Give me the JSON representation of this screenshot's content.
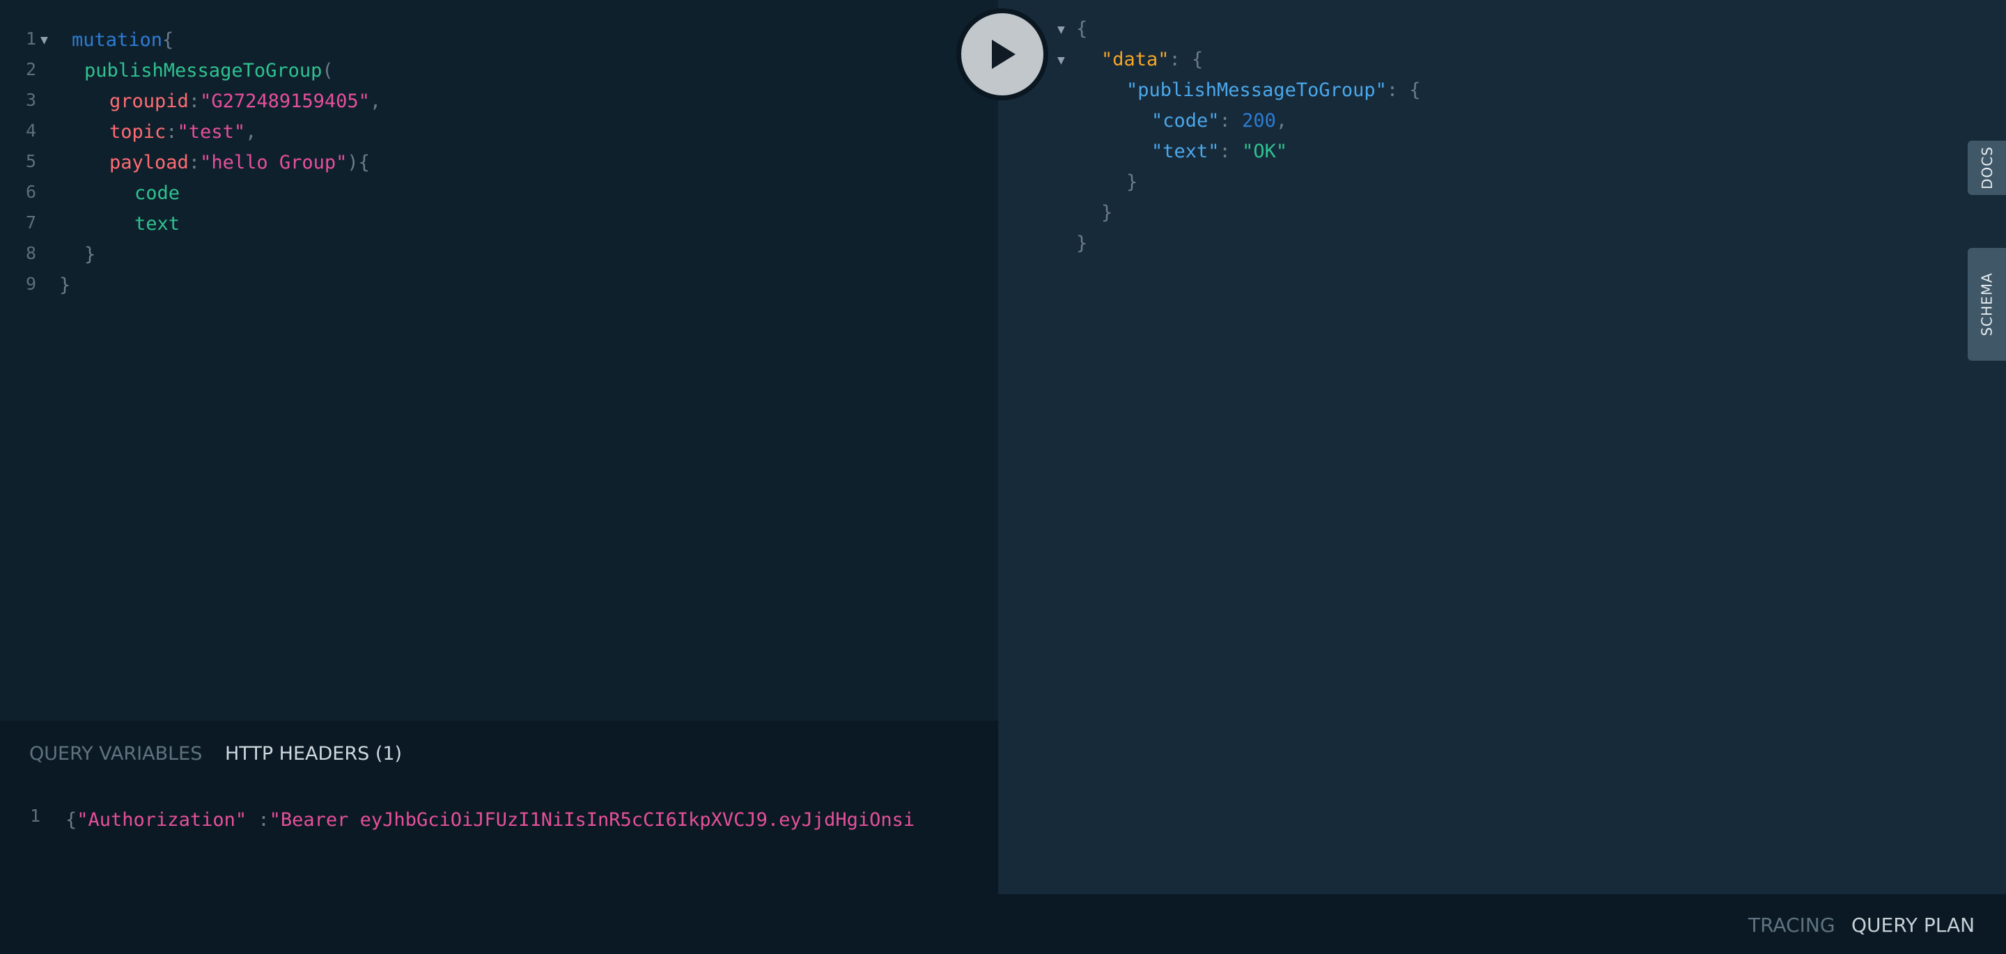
{
  "editor": {
    "line_numbers": [
      "1",
      "2",
      "3",
      "4",
      "5",
      "6",
      "7",
      "8",
      "9"
    ],
    "lines": {
      "l1_kw": "mutation",
      "l1_brace": "{",
      "l2_field": "publishMessageToGroup",
      "l2_paren": "(",
      "l3_arg": "groupid",
      "l3_colon": ":",
      "l3_str": "\"G272489159405\"",
      "l3_comma": ",",
      "l4_arg": "topic",
      "l4_colon": ":",
      "l4_str": "\"test\"",
      "l4_comma": ",",
      "l5_arg": "payload",
      "l5_colon": ":",
      "l5_str": "\"hello Group\"",
      "l5_close": "){",
      "l6_field": "code",
      "l7_field": "text",
      "l8_brace": "}",
      "l9_brace": "}"
    }
  },
  "run_button": {
    "icon": "play-icon"
  },
  "result": {
    "open_brace": "{",
    "data_key": "\"data\"",
    "colon_brace": ": {",
    "pub_key": "\"publishMessageToGroup\"",
    "code_key": "\"code\"",
    "colon": ": ",
    "code_val": "200",
    "comma": ",",
    "text_key": "\"text\"",
    "text_val": "\"OK\"",
    "close_brace": "}"
  },
  "side_tabs": {
    "docs": "DOCS",
    "schema": "SCHEMA"
  },
  "bottom": {
    "tabs": {
      "query_variables": "QUERY VARIABLES",
      "http_headers": "HTTP HEADERS (1)"
    },
    "line_number": "1",
    "header_open": "{",
    "header_key": "\"Authorization\"",
    "header_colon": " :",
    "header_value": "\"Bearer eyJhbGciOiJFUzI1NiIsInR5cCI6IkpXVCJ9.eyJjdHgiOnsi"
  },
  "footer": {
    "tracing": "TRACING",
    "query_plan": "QUERY PLAN"
  },
  "colors": {
    "keyword": "#2d7cd3",
    "field": "#2ec28f",
    "argument": "#ff6c72",
    "string": "#e6509a",
    "json_key_data": "#f5a623",
    "json_key": "#4aa8ea"
  }
}
